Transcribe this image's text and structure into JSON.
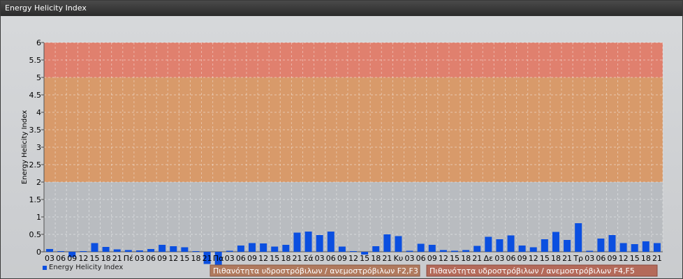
{
  "window": {
    "title": "Energy Helicity Index"
  },
  "colors": {
    "bar": "#0b4fe0",
    "band_high": "#e0806e",
    "band_mid": "#d89a6a",
    "band_low": "#b9bcc0",
    "plot_bg": "#b9bcc0",
    "band_f23": "#b07a5e",
    "band_f45": "#b46a5a"
  },
  "chart_data": {
    "type": "bar",
    "ylabel": "Energy Helicity Index",
    "xlabel": "",
    "ylim": [
      0,
      6
    ],
    "yticks": [
      "0",
      "0.5",
      "1",
      "1.5",
      "2",
      "2.5",
      "3",
      "3.5",
      "4",
      "4.5",
      "5",
      "5.5",
      "6"
    ],
    "grid": true,
    "categories": [
      "03",
      "06",
      "09",
      "12",
      "15",
      "18",
      "21",
      "Πέ",
      "03",
      "06",
      "09",
      "12",
      "15",
      "18",
      "21",
      "Πα",
      "03",
      "06",
      "09",
      "12",
      "15",
      "18",
      "21",
      "Σά",
      "03",
      "06",
      "09",
      "12",
      "15",
      "18",
      "21",
      "Κυ",
      "03",
      "06",
      "09",
      "12",
      "15",
      "18",
      "21",
      "Δε",
      "03",
      "06",
      "09",
      "12",
      "15",
      "18",
      "21",
      "Τρ",
      "03",
      "06",
      "09",
      "12",
      "15",
      "18",
      "21"
    ],
    "series": [
      {
        "name": "Energy Helicity Index",
        "values": [
          0.08,
          0.02,
          -0.15,
          0.02,
          0.25,
          0.14,
          0.07,
          0.05,
          0.04,
          0.08,
          0.2,
          0.16,
          0.13,
          0.02,
          -0.35,
          -0.5,
          0.03,
          0.18,
          0.25,
          0.24,
          0.15,
          0.2,
          0.55,
          0.58,
          0.48,
          0.58,
          0.15,
          0.02,
          -0.08,
          0.16,
          0.5,
          0.45,
          0.03,
          0.23,
          0.2,
          0.05,
          0.03,
          0.05,
          0.17,
          0.43,
          0.36,
          0.47,
          0.18,
          0.13,
          0.36,
          0.57,
          0.34,
          0.82,
          0.03,
          0.38,
          0.48,
          0.25,
          0.22,
          0.3,
          0.25
        ]
      }
    ],
    "bands": [
      {
        "from": 0,
        "to": 2,
        "level": "low"
      },
      {
        "from": 2,
        "to": 5,
        "level": "mid"
      },
      {
        "from": 5,
        "to": 6,
        "level": "high"
      }
    ],
    "legend": {
      "label": "Energy Helicity Index",
      "placement": "bottom-left"
    },
    "annotations": [
      {
        "text": "Πιθανότητα υδροστρόβιλων / ανεμοστρόβιλων F2,F3"
      },
      {
        "text": "Πιθανότητα υδροστρόβιλων / ανεμοστρόβιλων F4,F5"
      }
    ]
  }
}
